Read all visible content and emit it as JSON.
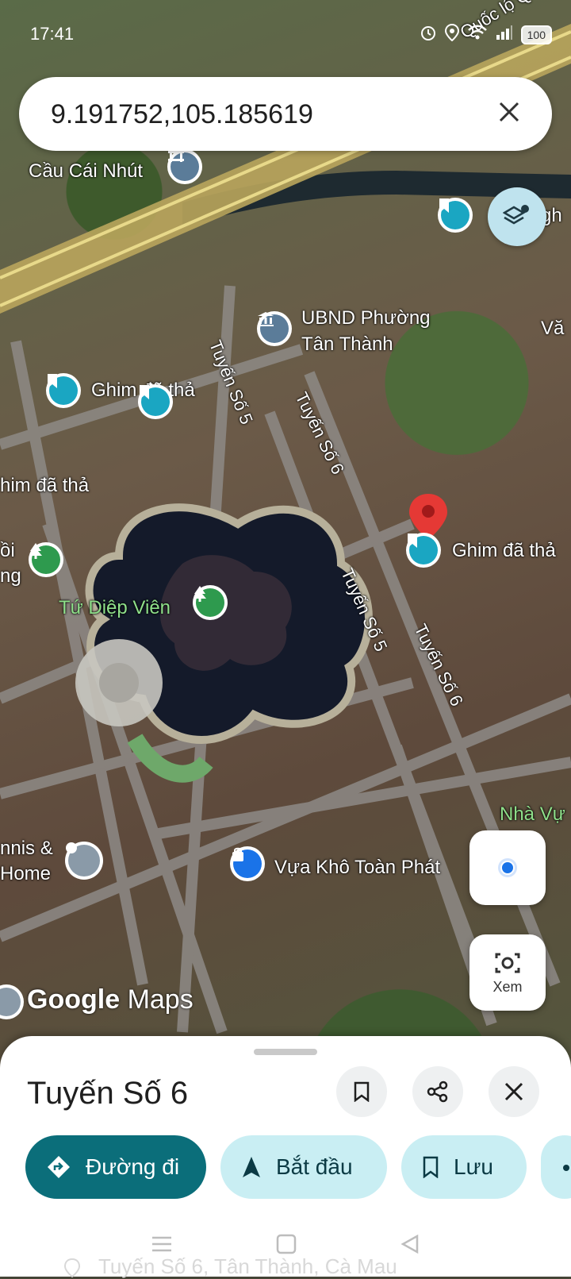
{
  "status": {
    "time": "17:41",
    "battery": "100"
  },
  "search": {
    "query": "9.191752,105.185619"
  },
  "map": {
    "road_label_top": "Quốc lộ Q",
    "labels": {
      "cau_cai_nhut": "Cầu Cái Nhút",
      "ubnd_line1": "UBND Phường",
      "ubnd_line2": "Tân Thành",
      "ghim_1": "Ghim đã thả",
      "ghim_2": "him đã thả",
      "ghim_3": "Ghim đã thả",
      "tuyen_so_5a": "Tuyến Số 5",
      "tuyen_so_6a": "Tuyến Số 6",
      "tuyen_so_5b": "Tuyến Số 5",
      "tuyen_so_6b": "Tuyến Số 6",
      "tu_diep_vien": "Tứ Diệp Viên",
      "vua_kho": "Vựa Khô Toàn Phát",
      "nha_vu": "Nhà Vự",
      "tennis_1": "nnis &",
      "tennis_2": "Home",
      "oi": "ồi",
      "ng": "ng",
      "van": "Vă",
      "gh": "gh"
    },
    "brand": {
      "google": "Google",
      "maps": "Maps"
    },
    "xem_label": "Xem"
  },
  "sheet": {
    "title": "Tuyến Số 6",
    "actions": {
      "directions": "Đường đi",
      "start": "Bắt đầu",
      "save": "Lưu"
    }
  },
  "footer_ghost": "Tuyến Số 6, Tân Thành, Cà Mau",
  "colors": {
    "accent": "#0b6e7a",
    "pill_light": "#c9eef3",
    "pin_blue": "#1aa6c2",
    "pin_green": "#2e9a4e",
    "red_pin": "#e53935"
  }
}
